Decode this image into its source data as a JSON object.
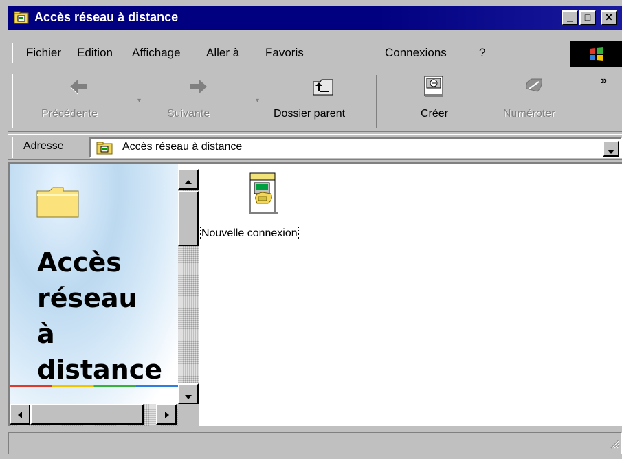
{
  "window": {
    "title": "Accès réseau à distance",
    "controls": {
      "minimize": "_",
      "maximize": "□",
      "close": "✕"
    }
  },
  "menu": {
    "items": [
      {
        "label": "Fichier"
      },
      {
        "label": "Edition"
      },
      {
        "label": "Affichage"
      },
      {
        "label": "Aller à"
      },
      {
        "label": "Favoris"
      },
      {
        "label": "Connexions"
      },
      {
        "label": "?"
      }
    ]
  },
  "toolbar": {
    "back": "Précédente",
    "forward": "Suivante",
    "up": "Dossier parent",
    "create": "Créer",
    "dial": "Numéroter",
    "more": "»"
  },
  "address": {
    "label": "Adresse",
    "value": "Accès réseau à distance"
  },
  "left_panel": {
    "heading": "Accès\nréseau\nà\ndistance"
  },
  "files": [
    {
      "label": "Nouvelle connexion",
      "icon": "new-connection-icon"
    }
  ],
  "status": {
    "text": ""
  }
}
